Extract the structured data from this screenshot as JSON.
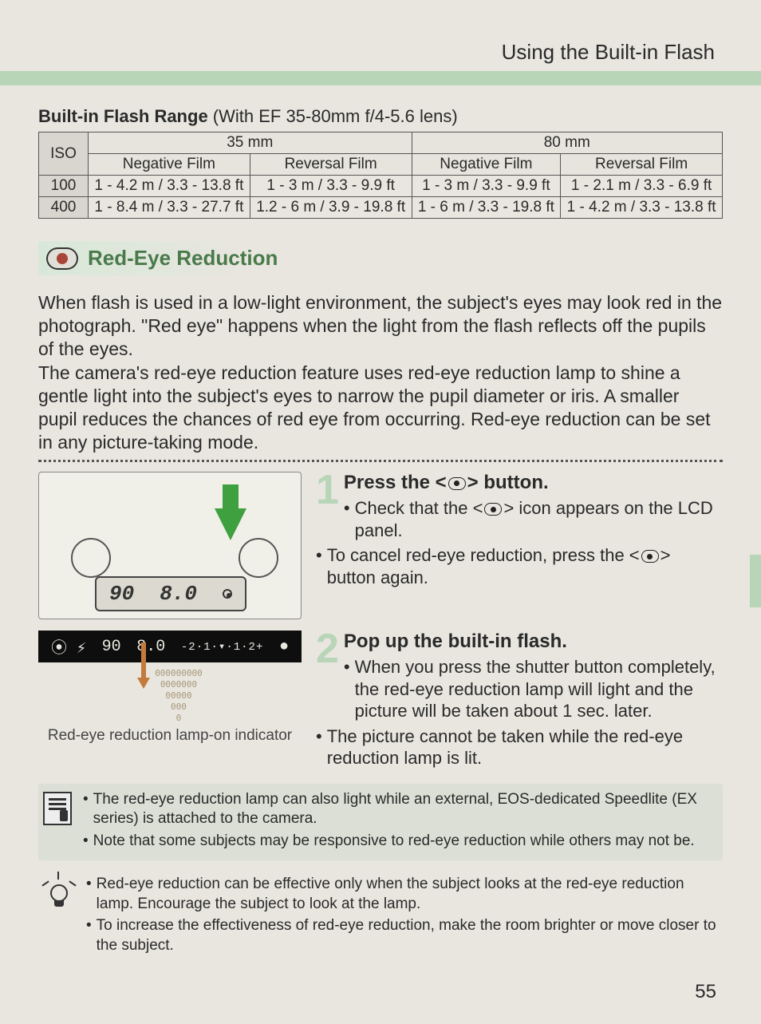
{
  "header": "Using the Built-in Flash",
  "table_title_bold": "Built-in Flash Range",
  "table_title_light": " (With EF 35-80mm f/4-5.6 lens)",
  "table": {
    "cols": {
      "iso": "ISO",
      "f35": "35 mm",
      "f80": "80 mm",
      "neg": "Negative Film",
      "rev": "Reversal Film"
    },
    "rows": [
      {
        "iso": "100",
        "c1": "1 - 4.2 m / 3.3 - 13.8 ft",
        "c2": "1 - 3 m / 3.3 - 9.9 ft",
        "c3": "1 - 3 m / 3.3 - 9.9 ft",
        "c4": "1 - 2.1 m / 3.3 - 6.9 ft"
      },
      {
        "iso": "400",
        "c1": "1 - 8.4 m / 3.3 - 27.7 ft",
        "c2": "1.2 - 6 m / 3.9 - 19.8 ft",
        "c3": "1 - 6 m / 3.3 - 19.8 ft",
        "c4": "1 - 4.2 m / 3.3 - 13.8 ft"
      }
    ]
  },
  "section_heading": "Red-Eye Reduction",
  "para1": "When flash is used in a low-light environment, the subject's eyes may look red in the photograph. \"Red eye\" happens when the light from the flash reflects off the pupils of the eyes.",
  "para2": "The camera's red-eye reduction feature uses red-eye reduction lamp to shine a gentle light into the subject's eyes to narrow the pupil diameter or iris. A smaller pupil reduces the chances of red eye from occurring. Red-eye reduction can be set in any picture-taking mode.",
  "lcd_readout": {
    "shutter": "90",
    "aperture": "8.0"
  },
  "lcd_strip": {
    "flash": "⦿ ⚡",
    "shutter": "90",
    "aperture": "8.0",
    "ev": "-2·1·▾·1·2+",
    "dot": "●"
  },
  "indicator_label": "Red-eye reduction lamp-on indicator",
  "step1": {
    "num": "1",
    "title_pre": "Press the <",
    "title_post": "> button.",
    "b1_pre": "Check that the <",
    "b1_post": "> icon appears on the LCD panel.",
    "b2_pre": "To cancel red-eye reduction, press the <",
    "b2_post": "> button again."
  },
  "step2": {
    "num": "2",
    "title": "Pop up the built-in flash.",
    "b1": "When you press the shutter button completely, the red-eye reduction lamp will light and the picture will be taken about 1 sec. later.",
    "b2": "The picture cannot be taken while the red-eye reduction lamp is lit."
  },
  "note1": {
    "a": "The red-eye reduction lamp can also light while an external, EOS-dedicated Speedlite (EX series) is attached to the camera.",
    "b": "Note that some subjects may be responsive to red-eye reduction while others may not be."
  },
  "note2": {
    "a": "Red-eye reduction can be effective only when the subject looks at the red-eye reduction lamp. Encourage the subject to look at the lamp.",
    "b": "To increase the effectiveness of red-eye reduction, make the room brighter or move closer to the subject."
  },
  "page_number": "55",
  "chart_data": {
    "type": "table",
    "title": "Built-in Flash Range (With EF 35-80mm f/4-5.6 lens)",
    "columns": [
      "ISO",
      "35 mm Negative Film",
      "35 mm Reversal Film",
      "80 mm Negative Film",
      "80 mm Reversal Film"
    ],
    "rows": [
      [
        "100",
        "1 - 4.2 m / 3.3 - 13.8 ft",
        "1 - 3 m / 3.3 - 9.9 ft",
        "1 - 3 m / 3.3 - 9.9 ft",
        "1 - 2.1 m / 3.3 - 6.9 ft"
      ],
      [
        "400",
        "1 - 8.4 m / 3.3 - 27.7 ft",
        "1.2 - 6 m / 3.9 - 19.8 ft",
        "1 - 6 m / 3.3 - 19.8 ft",
        "1 - 4.2 m / 3.3 - 13.8 ft"
      ]
    ]
  }
}
